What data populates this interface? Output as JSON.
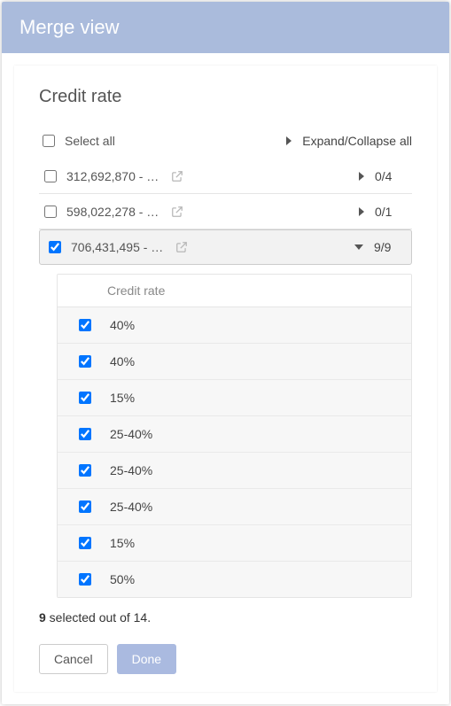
{
  "header": {
    "title": "Merge view"
  },
  "panel": {
    "title": "Credit rate"
  },
  "controls": {
    "select_all_label": "Select all",
    "select_all_checked": false,
    "expand_all_label": "Expand/Collapse all"
  },
  "groups": [
    {
      "checked": false,
      "label": "312,692,870 - …",
      "expanded": false,
      "count": "0/4"
    },
    {
      "checked": false,
      "label": "598,022,278 - …",
      "expanded": false,
      "count": "0/1"
    },
    {
      "checked": true,
      "label": "706,431,495 - …",
      "expanded": true,
      "count": "9/9"
    }
  ],
  "sub": {
    "header": "Credit rate",
    "rows": [
      {
        "checked": true,
        "value": "40%"
      },
      {
        "checked": true,
        "value": "40%"
      },
      {
        "checked": true,
        "value": "15%"
      },
      {
        "checked": true,
        "value": "25-40%"
      },
      {
        "checked": true,
        "value": "25-40%"
      },
      {
        "checked": true,
        "value": "25-40%"
      },
      {
        "checked": true,
        "value": "15%"
      },
      {
        "checked": true,
        "value": "50%"
      }
    ]
  },
  "status": {
    "selected": "9",
    "middle": " selected out of ",
    "total": "14",
    "suffix": "."
  },
  "footer": {
    "cancel": "Cancel",
    "done": "Done"
  }
}
